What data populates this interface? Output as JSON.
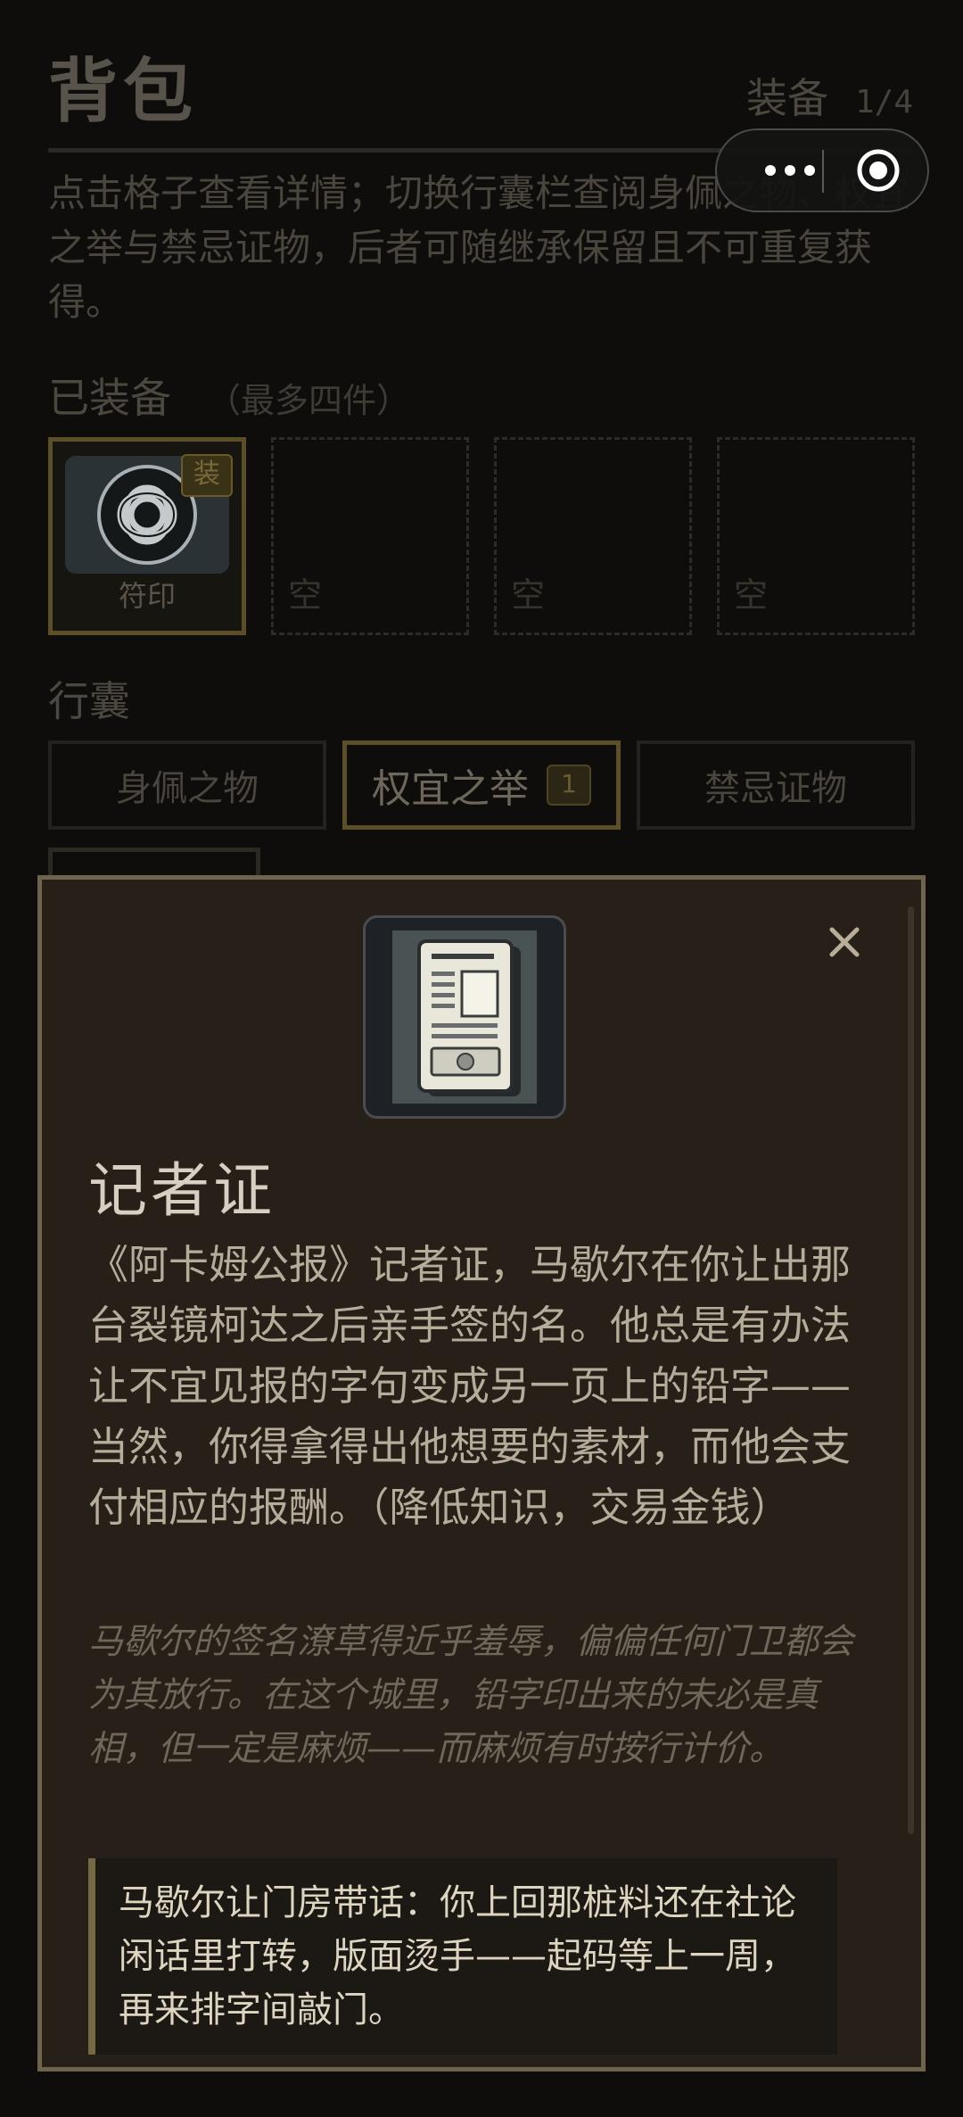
{
  "header": {
    "title": "背包",
    "equip_label": "装备",
    "equip_count": "1/4",
    "instructions": "点击格子查看详情；切换行囊栏查阅身佩之物、权宜之举与禁忌证物，后者可随继承保留且不可重复获得。"
  },
  "equipped": {
    "title": "已装备",
    "subtitle": "（最多四件）",
    "slots": [
      {
        "label": "符印",
        "badge": "装",
        "icon": "celtic-knot-seal-icon"
      },
      {
        "label": "空"
      },
      {
        "label": "空"
      },
      {
        "label": "空"
      }
    ]
  },
  "bag": {
    "title": "行囊",
    "tabs": [
      {
        "label": "身佩之物"
      },
      {
        "label": "权宜之举",
        "count": "1",
        "active": true
      },
      {
        "label": "禁忌证物"
      }
    ]
  },
  "capsule": {
    "more_icon": "more-dots-icon",
    "close_icon": "target-circle-icon"
  },
  "modal": {
    "close_icon": "close-icon",
    "item_icon": "press-card-icon",
    "name": "记者证",
    "description": "《阿卡姆公报》记者证，马歇尔在你让出那台裂镜柯达之后亲手签的名。他总是有办法让不宜见报的字句变成另一页上的铅字——当然，你得拿得出他想要的素材，而他会支付相应的报酬。（降低知识，交易金钱）",
    "flavor": "马歇尔的签名潦草得近乎羞辱，偏偏任何门卫都会为其放行。在这个城里，铅字印出来的未必是真相，但一定是麻烦——而麻烦有时按行计价。",
    "note": "马歇尔让门房带话：你上回那桩料还在社论闲话里打转，版面烫手——起码等上一周，再来排字间敲门。"
  },
  "colors": {
    "accent_gold": "#766842",
    "modal_bg": "#262019",
    "page_bg": "#0e0d0b"
  }
}
